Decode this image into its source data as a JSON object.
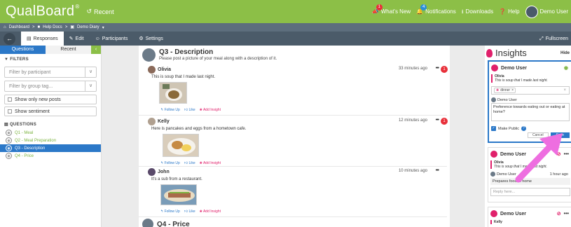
{
  "app": {
    "logo": "QualBoard",
    "logo_mark": "®",
    "recent": "Recent"
  },
  "topbar": {
    "whats_new": "What's New",
    "whats_new_count": "1",
    "notifications": "Notifications",
    "notifications_count": "4",
    "downloads": "Downloads",
    "help": "Help",
    "user": "Demo User"
  },
  "breadcrumb": {
    "items": [
      "Dashboard",
      "Help Docs",
      "Demo Diary"
    ]
  },
  "tabs": {
    "responses": "Responses",
    "edit": "Edit",
    "participants": "Participants",
    "settings": "Settings",
    "fullscreen": "Fullscreen"
  },
  "left": {
    "tab_questions": "Questions",
    "tab_recent": "Recent",
    "filters_title": "FILTERS",
    "participant_placeholder": "Filter by participant",
    "group_placeholder": "Filter by group tag...",
    "show_new": "Show only new posts",
    "show_sentiment": "Show sentiment",
    "questions_title": "QUESTIONS",
    "questions": [
      "Q1 - Meal",
      "Q2 - Meal Preparation",
      "Q3 - Description",
      "Q4 - Price"
    ]
  },
  "main": {
    "question_title": "Q3 - Description",
    "question_desc": "Please post a picture of your meal along with a description of it.",
    "posts": [
      {
        "name": "Olivia",
        "time": "33 minutes ago",
        "badge": "1",
        "text": "This is soup that I made last night."
      },
      {
        "name": "Kelly",
        "time": "12 minutes ago",
        "badge": "1",
        "text": "Here is pancakes and eggs from a hometown cafe."
      },
      {
        "name": "John",
        "time": "10 minutes ago",
        "badge": "",
        "text": "It's a sub from a restaurant."
      }
    ],
    "actions": {
      "follow_up": "Follow Up",
      "like": "Like",
      "add_insight": "Add Insight"
    },
    "next_question": "Q4 - Price"
  },
  "insights": {
    "title": "Insights",
    "hide": "Hide",
    "card1": {
      "user": "Demo User",
      "quote_name": "Olivia",
      "quote_text": "This is soup that I made last night.",
      "tag": "dinner",
      "author": "Demo User",
      "note": "Preference towards eating out or eating at home?",
      "make_public": "Make Public",
      "cancel": "Cancel",
      "save": "Save"
    },
    "card2": {
      "user": "Demo User",
      "quote_name": "Olivia",
      "quote_text": "This is soup that I made last night.",
      "author": "Demo User",
      "time": "1 hour ago",
      "note": "Prepares food at home",
      "reply_placeholder": "Reply here..."
    },
    "card3": {
      "user": "Demo User",
      "quote_name": "Kelly"
    }
  },
  "colors": {
    "brand_green": "#8cbf47",
    "accent_blue": "#2b78c8",
    "insight_pink": "#e0206b",
    "arrow": "#ee6ee0"
  }
}
